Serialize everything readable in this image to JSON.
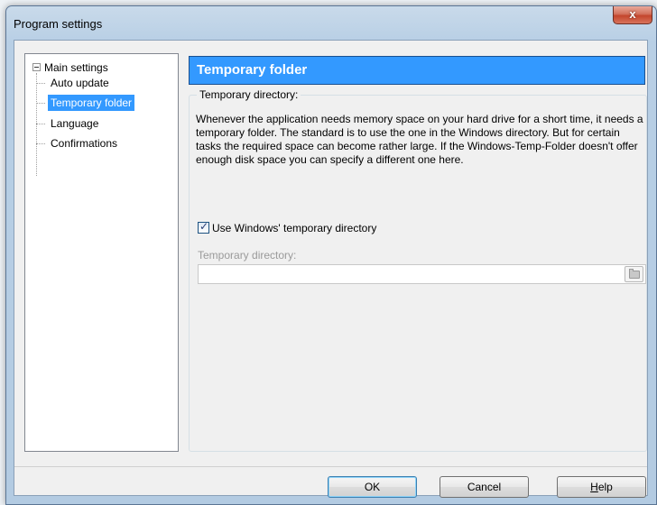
{
  "window": {
    "title": "Program settings",
    "close_glyph": "x"
  },
  "tree": {
    "root_label": "Main settings",
    "items": [
      {
        "label": "Auto update",
        "selected": false
      },
      {
        "label": "Temporary folder",
        "selected": true
      },
      {
        "label": "Language",
        "selected": false
      },
      {
        "label": "Confirmations",
        "selected": false
      }
    ]
  },
  "panel": {
    "header": "Temporary folder",
    "group_title": "Temporary directory:",
    "description": "Whenever the application needs memory space on your hard drive for a short time, it needs a temporary folder. The standard is to use the one in the Windows directory. But for certain tasks the required space can become rather large. If the Windows-Temp-Folder doesn't offer enough disk space you can specify a different one here.",
    "checkbox_label": "Use Windows' temporary directory",
    "checkbox_checked": true,
    "dir_label": "Temporary directory:",
    "dir_value": ""
  },
  "buttons": {
    "ok": "OK",
    "cancel": "Cancel",
    "help_first": "H",
    "help_rest": "elp"
  },
  "colors": {
    "selection": "#3399ff",
    "header_bg": "#3399ff"
  }
}
